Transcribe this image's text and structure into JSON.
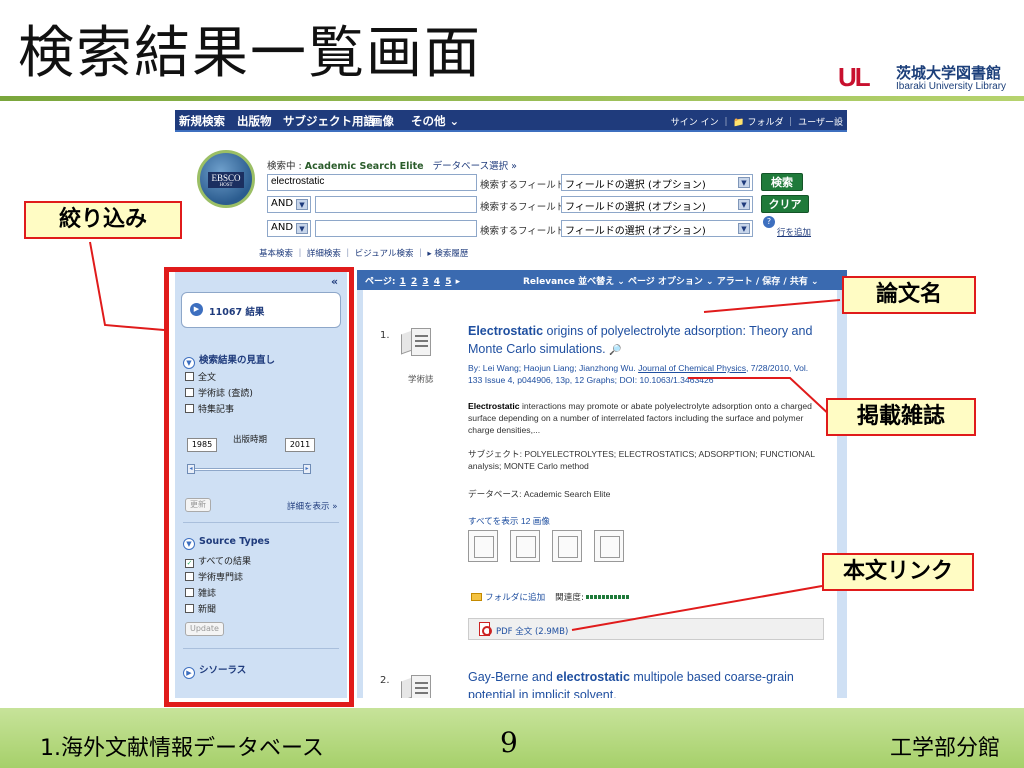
{
  "slide": {
    "title": "検索結果一覧画面",
    "logo_mark": "UL",
    "logo_jp": "茨城大学図書館",
    "logo_en": "Ibaraki University Library",
    "footer_left": "1.海外文献情報データベース",
    "page_number": "9",
    "footer_right": "工学部分館",
    "accent_color": "#a6d06a",
    "callout_color": "#e01b1b"
  },
  "callouts": {
    "refine": "絞り込み",
    "article_title": "論文名",
    "journal": "掲載雑誌",
    "fulltext": "本文リンク"
  },
  "navbar": {
    "items": [
      "新規検索",
      "出版物",
      "サブジェクト用語",
      "画像",
      "その他 ⌄"
    ],
    "right": "サイン イン ｜ 📁 フォルダ ｜ ユーザー設"
  },
  "search": {
    "searching_label": "検索中 :",
    "database": "Academic Search Elite",
    "db_select_link": "データベース選択 »",
    "query": "electrostatic",
    "field_label": "検索するフィールド",
    "field_option": "フィールドの選択 (オプション)",
    "bool_op": "AND",
    "search_button": "検索",
    "clear_button": "クリア",
    "add_row_link": "行を追加",
    "links": "基本検索 ｜ 詳細検索 ｜ ビジュアル検索 ｜ ▸ 検索履歴",
    "logo_text": "EBSCO",
    "logo_sub": "HOST"
  },
  "sidebar": {
    "collapse": "«",
    "results_count": "11067 結果",
    "refine_heading": "検索結果の見直し",
    "filters": [
      "全文",
      "学術誌 (査読)",
      "特集記事"
    ],
    "year_from": "1985",
    "year_label": "出版時期",
    "year_to": "2011",
    "update_btn": "更新",
    "show_more": "詳細を表示 »",
    "source_types_heading": "Source Types",
    "source_types": [
      "すべての結果",
      "学術専門誌",
      "雑誌",
      "新聞"
    ],
    "source_update_btn": "Update",
    "thesaurus": "シソーラス"
  },
  "results_bar": {
    "pages_label": "ページ:",
    "pages": [
      "1",
      "2",
      "3",
      "4",
      "5"
    ],
    "next": "▸",
    "options": "Relevance 並べ替え ⌄  ページ オプション ⌄  アラート / 保存 / 共有 ⌄"
  },
  "results": [
    {
      "num": "1.",
      "type": "学術誌",
      "title_bold": "Electrostatic",
      "title_rest": " origins of polyelectrolyte adsorption: Theory and Monte Carlo simulations.",
      "byline_pre": "By: Lei Wang; Haojun Liang; Jianzhong Wu. ",
      "journal": "Journal of Chemical Physics",
      "byline_post": ", 7/28/2010, Vol. 133 Issue 4, p044906, 13p, 12 Graphs; DOI: 10.1063/1.3463426",
      "abstract_bold": "Electrostatic",
      "abstract_rest": " interactions may promote or abate polyelectrolyte adsorption onto a charged surface depending on a number of interrelated factors including the surface and polymer charge densities,...",
      "subjects": "サブジェクト: POLYELECTROLYTES; ELECTROSTATICS; ADSORPTION; FUNCTIONAL analysis; MONTE Carlo method",
      "database": "データベース: Academic Search Elite",
      "images_link": "すべてを表示 12 画像",
      "folder_link": "フォルダに追加",
      "relevance_label": "関連度:",
      "pdf_link": "PDF 全文 (2.9MB)"
    },
    {
      "num": "2.",
      "title_pre": "Gay-Berne and ",
      "title_bold": "electrostatic",
      "title_rest": " multipole based coarse-grain potential in implicit solvent."
    }
  ]
}
